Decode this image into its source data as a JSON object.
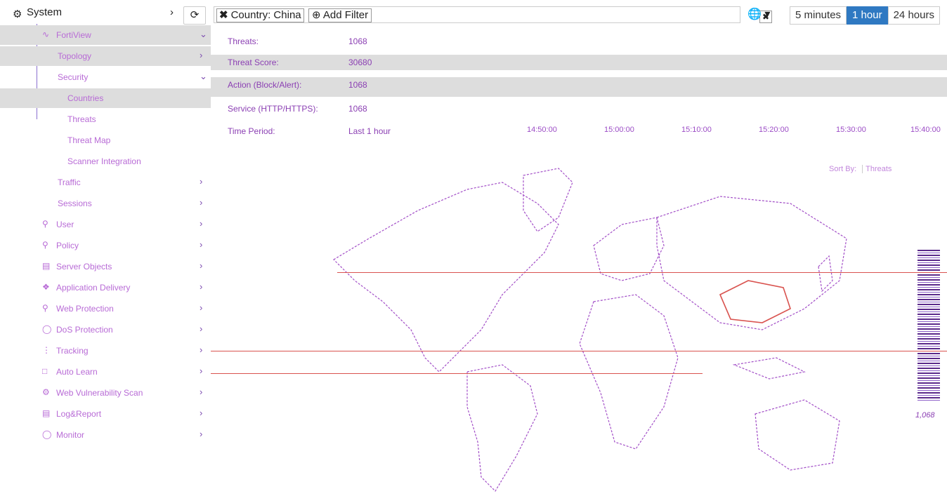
{
  "sidebar": {
    "title": "System",
    "items": [
      {
        "label": "FortiView",
        "expanded": true,
        "selected": true
      },
      {
        "label": "Topology",
        "selected": true
      },
      {
        "label": "Security",
        "expanded": true
      },
      {
        "label": "Countries",
        "selected": true
      },
      {
        "label": "Threats"
      },
      {
        "label": "Threat Map"
      },
      {
        "label": "Scanner Integration"
      },
      {
        "label": "Traffic"
      },
      {
        "label": "Sessions"
      },
      {
        "label": "User"
      },
      {
        "label": "Policy"
      },
      {
        "label": "Server Objects"
      },
      {
        "label": "Application Delivery"
      },
      {
        "label": "Web Protection"
      },
      {
        "label": "DoS Protection"
      },
      {
        "label": "Tracking"
      },
      {
        "label": "Auto Learn"
      },
      {
        "label": "Web Vulnerability Scan"
      },
      {
        "label": "Log&Report"
      },
      {
        "label": "Monitor"
      }
    ]
  },
  "toolbar": {
    "filter_chip": "Country: China",
    "add_filter": "Add Filter",
    "time_ranges": [
      "5 minutes",
      "1 hour",
      "24 hours"
    ],
    "active_range": "1 hour"
  },
  "stats": {
    "rows": [
      {
        "key": "Threats:",
        "value": "1068"
      },
      {
        "key": "Threat Score:",
        "value": "30680"
      },
      {
        "key": "Action (Block/Alert):",
        "value": "1068"
      },
      {
        "key": "Service (HTTP/HTTPS):",
        "value": "1068"
      },
      {
        "key": "Time Period:",
        "value": "Last 1 hour"
      }
    ],
    "x_ticks": [
      "14:50:00",
      "15:00:00",
      "15:10:00",
      "15:20:00",
      "15:30:00",
      "15:40:00"
    ]
  },
  "sort": {
    "label": "Sort By:",
    "value": "Threats"
  },
  "map": {
    "highlight_country": "China",
    "legend_max": "1,068"
  },
  "colors": {
    "accent": "#2f79c2",
    "map_line": "#a24ec7",
    "highlight": "#d9534f"
  }
}
